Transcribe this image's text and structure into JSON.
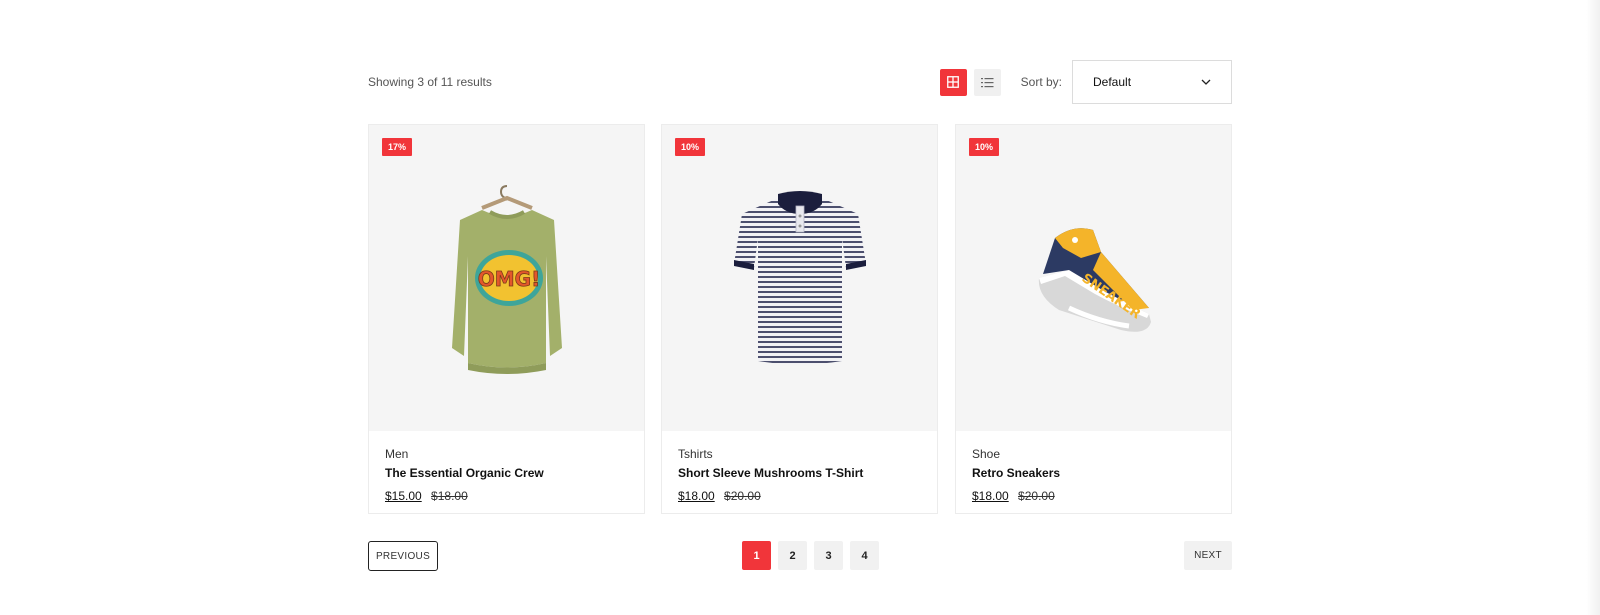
{
  "toolbar": {
    "results_text": "Showing 3 of 11 results",
    "grid_view_icon": "grid-icon",
    "list_view_icon": "list-icon",
    "sort_label": "Sort by:",
    "sort_value": "Default",
    "sort_chevron_icon": "chevron-down-icon"
  },
  "colors": {
    "accent": "#f1353a",
    "card_image_bg": "#f5f5f5"
  },
  "products": [
    {
      "badge": "17%",
      "category": "Men",
      "name": "The Essential Organic Crew",
      "price": "$15.00",
      "old_price": "$18.00",
      "image": "green-sweatshirt-image"
    },
    {
      "badge": "10%",
      "category": "Tshirts",
      "name": "Short Sleeve Mushrooms T-Shirt",
      "price": "$18.00",
      "old_price": "$20.00",
      "image": "striped-polo-shirt-image"
    },
    {
      "badge": "10%",
      "category": "Shoe",
      "name": "Retro Sneakers",
      "price": "$18.00",
      "old_price": "$20.00",
      "image": "sneaker-image"
    }
  ],
  "pagination": {
    "previous_label": "PREVIOUS",
    "pages": [
      "1",
      "2",
      "3",
      "4"
    ],
    "current_page": "1",
    "next_label": "NEXT"
  }
}
